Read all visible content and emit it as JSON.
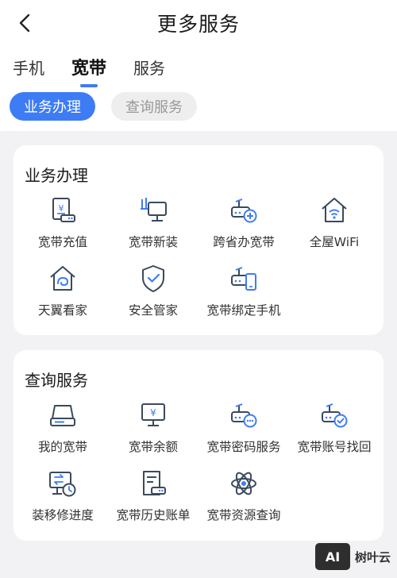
{
  "header": {
    "title": "更多服务"
  },
  "tabs": [
    {
      "label": "手机"
    },
    {
      "label": "宽带"
    },
    {
      "label": "服务"
    }
  ],
  "chips": [
    {
      "label": "业务办理"
    },
    {
      "label": "查询服务"
    }
  ],
  "sections": [
    {
      "title": "业务办理",
      "items": [
        {
          "label": "宽带充值",
          "icon": "broadband-topup-icon"
        },
        {
          "label": "宽带新装",
          "icon": "broadband-install-icon"
        },
        {
          "label": "跨省办宽带",
          "icon": "cross-province-router-icon"
        },
        {
          "label": "全屋WiFi",
          "icon": "home-wifi-icon"
        },
        {
          "label": "天翼看家",
          "icon": "home-camera-icon"
        },
        {
          "label": "安全管家",
          "icon": "shield-check-icon"
        },
        {
          "label": "宽带绑定手机",
          "icon": "router-phone-icon"
        }
      ]
    },
    {
      "title": "查询服务",
      "items": [
        {
          "label": "我的宽带",
          "icon": "router-icon"
        },
        {
          "label": "宽带余额",
          "icon": "monitor-yen-icon"
        },
        {
          "label": "宽带密码服务",
          "icon": "router-password-icon"
        },
        {
          "label": "宽带账号找回",
          "icon": "router-check-icon"
        },
        {
          "label": "装移修进度",
          "icon": "monitor-clock-icon"
        },
        {
          "label": "宽带历史账单",
          "icon": "bill-icon"
        },
        {
          "label": "宽带资源查询",
          "icon": "atom-icon"
        }
      ]
    }
  ],
  "watermark": {
    "logo": "AI",
    "text": "树叶云"
  },
  "colors": {
    "accent": "#3e7cf6",
    "icon_stroke": "#3a4a5c"
  }
}
